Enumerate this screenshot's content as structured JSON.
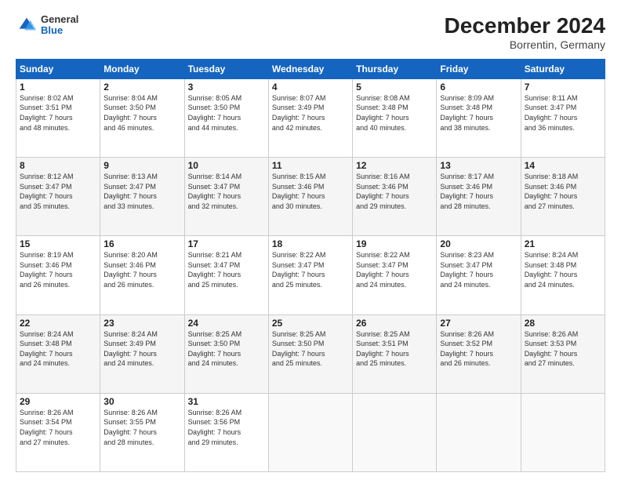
{
  "header": {
    "title": "December 2024",
    "subtitle": "Borrentin, Germany",
    "logo_general": "General",
    "logo_blue": "Blue"
  },
  "calendar": {
    "days_of_week": [
      "Sunday",
      "Monday",
      "Tuesday",
      "Wednesday",
      "Thursday",
      "Friday",
      "Saturday"
    ],
    "weeks": [
      [
        null,
        null,
        null,
        null,
        null,
        null,
        null
      ]
    ]
  },
  "cells": [
    {
      "day": 1,
      "col": 0,
      "sunrise": "8:02 AM",
      "sunset": "3:51 PM",
      "daylight": "7 hours and 48 minutes."
    },
    {
      "day": 2,
      "col": 1,
      "sunrise": "8:04 AM",
      "sunset": "3:50 PM",
      "daylight": "7 hours and 46 minutes."
    },
    {
      "day": 3,
      "col": 2,
      "sunrise": "8:05 AM",
      "sunset": "3:50 PM",
      "daylight": "7 hours and 44 minutes."
    },
    {
      "day": 4,
      "col": 3,
      "sunrise": "8:07 AM",
      "sunset": "3:49 PM",
      "daylight": "7 hours and 42 minutes."
    },
    {
      "day": 5,
      "col": 4,
      "sunrise": "8:08 AM",
      "sunset": "3:48 PM",
      "daylight": "7 hours and 40 minutes."
    },
    {
      "day": 6,
      "col": 5,
      "sunrise": "8:09 AM",
      "sunset": "3:48 PM",
      "daylight": "7 hours and 38 minutes."
    },
    {
      "day": 7,
      "col": 6,
      "sunrise": "8:11 AM",
      "sunset": "3:47 PM",
      "daylight": "7 hours and 36 minutes."
    },
    {
      "day": 8,
      "col": 0,
      "sunrise": "8:12 AM",
      "sunset": "3:47 PM",
      "daylight": "7 hours and 35 minutes."
    },
    {
      "day": 9,
      "col": 1,
      "sunrise": "8:13 AM",
      "sunset": "3:47 PM",
      "daylight": "7 hours and 33 minutes."
    },
    {
      "day": 10,
      "col": 2,
      "sunrise": "8:14 AM",
      "sunset": "3:47 PM",
      "daylight": "7 hours and 32 minutes."
    },
    {
      "day": 11,
      "col": 3,
      "sunrise": "8:15 AM",
      "sunset": "3:46 PM",
      "daylight": "7 hours and 30 minutes."
    },
    {
      "day": 12,
      "col": 4,
      "sunrise": "8:16 AM",
      "sunset": "3:46 PM",
      "daylight": "7 hours and 29 minutes."
    },
    {
      "day": 13,
      "col": 5,
      "sunrise": "8:17 AM",
      "sunset": "3:46 PM",
      "daylight": "7 hours and 28 minutes."
    },
    {
      "day": 14,
      "col": 6,
      "sunrise": "8:18 AM",
      "sunset": "3:46 PM",
      "daylight": "7 hours and 27 minutes."
    },
    {
      "day": 15,
      "col": 0,
      "sunrise": "8:19 AM",
      "sunset": "3:46 PM",
      "daylight": "7 hours and 26 minutes."
    },
    {
      "day": 16,
      "col": 1,
      "sunrise": "8:20 AM",
      "sunset": "3:46 PM",
      "daylight": "7 hours and 26 minutes."
    },
    {
      "day": 17,
      "col": 2,
      "sunrise": "8:21 AM",
      "sunset": "3:47 PM",
      "daylight": "7 hours and 25 minutes."
    },
    {
      "day": 18,
      "col": 3,
      "sunrise": "8:22 AM",
      "sunset": "3:47 PM",
      "daylight": "7 hours and 25 minutes."
    },
    {
      "day": 19,
      "col": 4,
      "sunrise": "8:22 AM",
      "sunset": "3:47 PM",
      "daylight": "7 hours and 24 minutes."
    },
    {
      "day": 20,
      "col": 5,
      "sunrise": "8:23 AM",
      "sunset": "3:47 PM",
      "daylight": "7 hours and 24 minutes."
    },
    {
      "day": 21,
      "col": 6,
      "sunrise": "8:24 AM",
      "sunset": "3:48 PM",
      "daylight": "7 hours and 24 minutes."
    },
    {
      "day": 22,
      "col": 0,
      "sunrise": "8:24 AM",
      "sunset": "3:48 PM",
      "daylight": "7 hours and 24 minutes."
    },
    {
      "day": 23,
      "col": 1,
      "sunrise": "8:24 AM",
      "sunset": "3:49 PM",
      "daylight": "7 hours and 24 minutes."
    },
    {
      "day": 24,
      "col": 2,
      "sunrise": "8:25 AM",
      "sunset": "3:50 PM",
      "daylight": "7 hours and 24 minutes."
    },
    {
      "day": 25,
      "col": 3,
      "sunrise": "8:25 AM",
      "sunset": "3:50 PM",
      "daylight": "7 hours and 25 minutes."
    },
    {
      "day": 26,
      "col": 4,
      "sunrise": "8:25 AM",
      "sunset": "3:51 PM",
      "daylight": "7 hours and 25 minutes."
    },
    {
      "day": 27,
      "col": 5,
      "sunrise": "8:26 AM",
      "sunset": "3:52 PM",
      "daylight": "7 hours and 26 minutes."
    },
    {
      "day": 28,
      "col": 6,
      "sunrise": "8:26 AM",
      "sunset": "3:53 PM",
      "daylight": "7 hours and 27 minutes."
    },
    {
      "day": 29,
      "col": 0,
      "sunrise": "8:26 AM",
      "sunset": "3:54 PM",
      "daylight": "7 hours and 27 minutes."
    },
    {
      "day": 30,
      "col": 1,
      "sunrise": "8:26 AM",
      "sunset": "3:55 PM",
      "daylight": "7 hours and 28 minutes."
    },
    {
      "day": 31,
      "col": 2,
      "sunrise": "8:26 AM",
      "sunset": "3:56 PM",
      "daylight": "7 hours and 29 minutes."
    }
  ],
  "labels": {
    "sunrise": "Sunrise:",
    "sunset": "Sunset:",
    "daylight": "Daylight:"
  }
}
